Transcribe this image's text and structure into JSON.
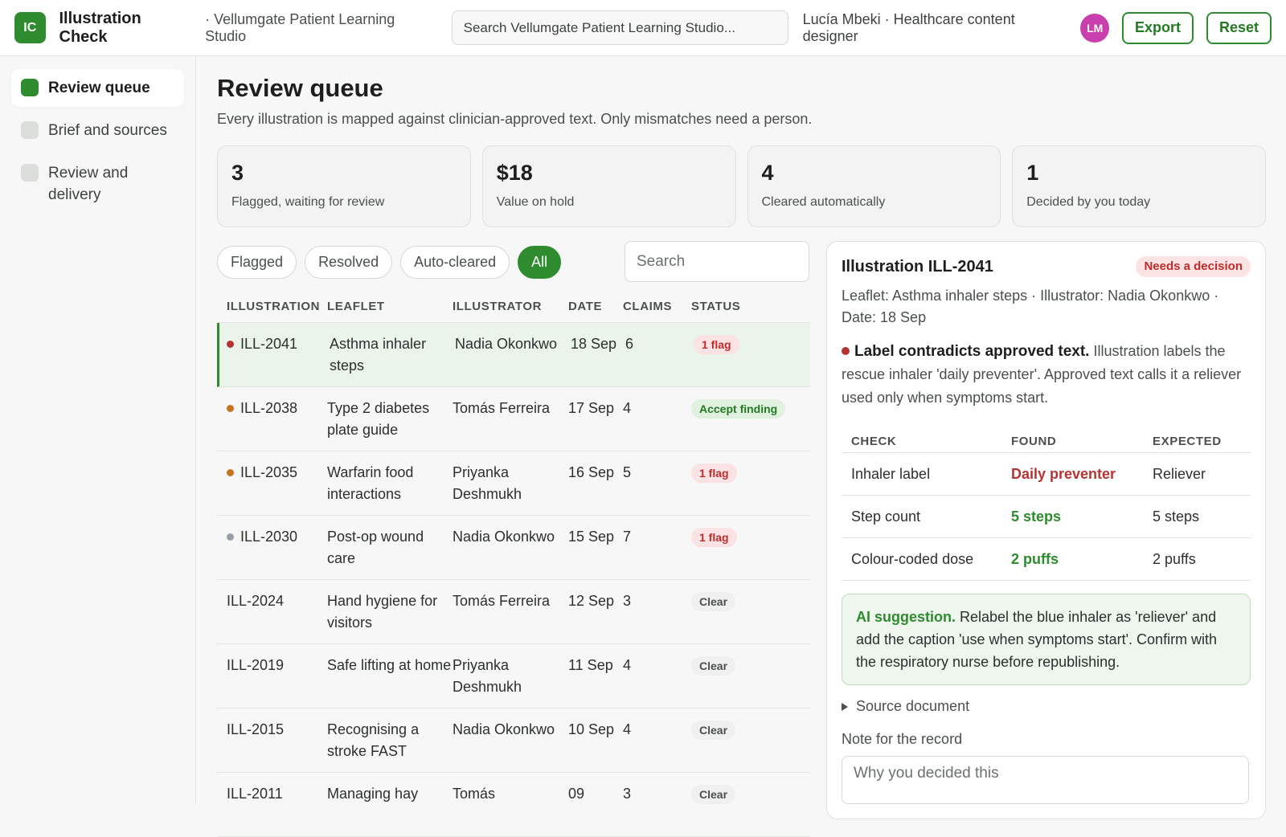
{
  "app": {
    "logo": "IC",
    "title": "Illustration Check",
    "workspace": "· Vellumgate Patient Learning Studio",
    "search_placeholder": "Search Vellumgate Patient Learning Studio...",
    "user": "Lucía Mbeki · Healthcare content designer",
    "avatar": "LM",
    "export_label": "Export",
    "reset_label": "Reset",
    "accent": "#2e8b2e",
    "avatar_color": "#c93fae"
  },
  "sidebar": {
    "items": [
      {
        "label": "Review queue",
        "active": true
      },
      {
        "label": "Brief and sources",
        "active": false
      },
      {
        "label": "Review and delivery",
        "active": false
      }
    ]
  },
  "main": {
    "title": "Review queue",
    "subtitle": "Every illustration is mapped against clinician-approved text. Only mismatches need a person."
  },
  "stats": [
    {
      "value": "3",
      "label": "Flagged, waiting for review"
    },
    {
      "value": "$18",
      "label": "Value on hold"
    },
    {
      "value": "4",
      "label": "Cleared automatically"
    },
    {
      "value": "1",
      "label": "Decided by you today"
    }
  ],
  "filters": {
    "chips": [
      "Flagged",
      "Resolved",
      "Auto-cleared",
      "All"
    ],
    "active": "All",
    "search_placeholder": "Search"
  },
  "table": {
    "headers": [
      "ILLUSTRATION",
      "LEAFLET",
      "ILLUSTRATOR",
      "DATE",
      "CLAIMS",
      "STATUS"
    ],
    "rows": [
      {
        "id": "ILL-2041",
        "leaflet": "Asthma inhaler steps",
        "illustrator": "Nadia Okonkwo",
        "date": "18 Sep",
        "claims": "6",
        "status": "1 flag",
        "status_type": "flag",
        "severity": "#b63333",
        "selected": true
      },
      {
        "id": "ILL-2038",
        "leaflet": "Type 2 diabetes plate guide",
        "illustrator": "Tomás Ferreira",
        "date": "17 Sep",
        "claims": "4",
        "status": "Accept finding",
        "status_type": "accept",
        "severity": "#c8741f",
        "selected": false
      },
      {
        "id": "ILL-2035",
        "leaflet": "Warfarin food interactions",
        "illustrator": "Priyanka Deshmukh",
        "date": "16 Sep",
        "claims": "5",
        "status": "1 flag",
        "status_type": "flag",
        "severity": "#c8741f",
        "selected": false
      },
      {
        "id": "ILL-2030",
        "leaflet": "Post-op wound care",
        "illustrator": "Nadia Okonkwo",
        "date": "15 Sep",
        "claims": "7",
        "status": "1 flag",
        "status_type": "flag",
        "severity": "#9a9ea8",
        "selected": false
      },
      {
        "id": "ILL-2024",
        "leaflet": "Hand hygiene for visitors",
        "illustrator": "Tomás Ferreira",
        "date": "12 Sep",
        "claims": "3",
        "status": "Clear",
        "status_type": "clear",
        "severity": "",
        "selected": false
      },
      {
        "id": "ILL-2019",
        "leaflet": "Safe lifting at home",
        "illustrator": "Priyanka Deshmukh",
        "date": "11 Sep",
        "claims": "4",
        "status": "Clear",
        "status_type": "clear",
        "severity": "",
        "selected": false
      },
      {
        "id": "ILL-2015",
        "leaflet": "Recognising a stroke FAST",
        "illustrator": "Nadia Okonkwo",
        "date": "10 Sep",
        "claims": "4",
        "status": "Clear",
        "status_type": "clear",
        "severity": "",
        "selected": false
      },
      {
        "id": "ILL-2011",
        "leaflet": "Managing hay",
        "illustrator": "Tomás",
        "date": "09",
        "claims": "3",
        "status": "Clear",
        "status_type": "clear",
        "severity": "",
        "selected": false
      }
    ]
  },
  "detail": {
    "title": "Illustration ILL-2041",
    "badge": "Needs a decision",
    "meta": "Leaflet: Asthma inhaler steps · Illustrator: Nadia Okonkwo · Date: 18 Sep",
    "finding_lead": "Label contradicts approved text.",
    "finding_text": " Illustration labels the rescue inhaler 'daily preventer'. Approved text calls it a reliever used only when symptoms start.",
    "check_headers": [
      "CHECK",
      "FOUND",
      "EXPECTED"
    ],
    "checks": [
      {
        "check": "Inhaler label",
        "found": "Daily preventer",
        "expected": "Reliever",
        "ok": false
      },
      {
        "check": "Step count",
        "found": "5 steps",
        "expected": "5 steps",
        "ok": true
      },
      {
        "check": "Colour-coded dose",
        "found": "2 puffs",
        "expected": "2 puffs",
        "ok": true
      }
    ],
    "ai_lead": "AI suggestion.",
    "ai_text": " Relabel the blue inhaler as 'reliever' and add the caption 'use when symptoms start'. Confirm with the respiratory nurse before republishing.",
    "source_label": "Source document",
    "note_label": "Note for the record",
    "note_placeholder": "Why you decided this"
  }
}
